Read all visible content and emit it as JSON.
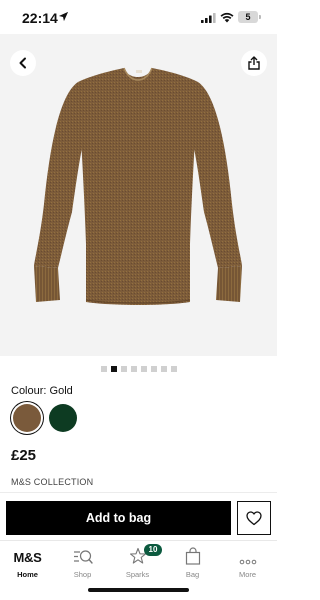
{
  "status_bar": {
    "time": "22:14",
    "battery": "5"
  },
  "product": {
    "colour_label": "Colour:",
    "colour_value": "Gold",
    "colours": [
      {
        "name": "Gold",
        "hex": "#7a5a3b",
        "selected": true
      },
      {
        "name": "Green",
        "hex": "#0d3b22",
        "selected": false
      }
    ],
    "price": "£25",
    "brand": "M&S COLLECTION",
    "image_count": 8,
    "active_image_index": 1
  },
  "actions": {
    "add_to_bag_label": "Add to bag"
  },
  "tabs": [
    {
      "label": "Home",
      "icon": "ms-logo",
      "logo_text": "M&S",
      "active": true
    },
    {
      "label": "Shop",
      "icon": "search-list-icon",
      "active": false
    },
    {
      "label": "Sparks",
      "icon": "sparks-star-icon",
      "badge": "10",
      "active": false
    },
    {
      "label": "Bag",
      "icon": "bag-icon",
      "active": false
    },
    {
      "label": "More",
      "icon": "more-dots-icon",
      "active": false
    }
  ],
  "colors": {
    "accent": "#000000",
    "badge": "#0c5a3f"
  }
}
